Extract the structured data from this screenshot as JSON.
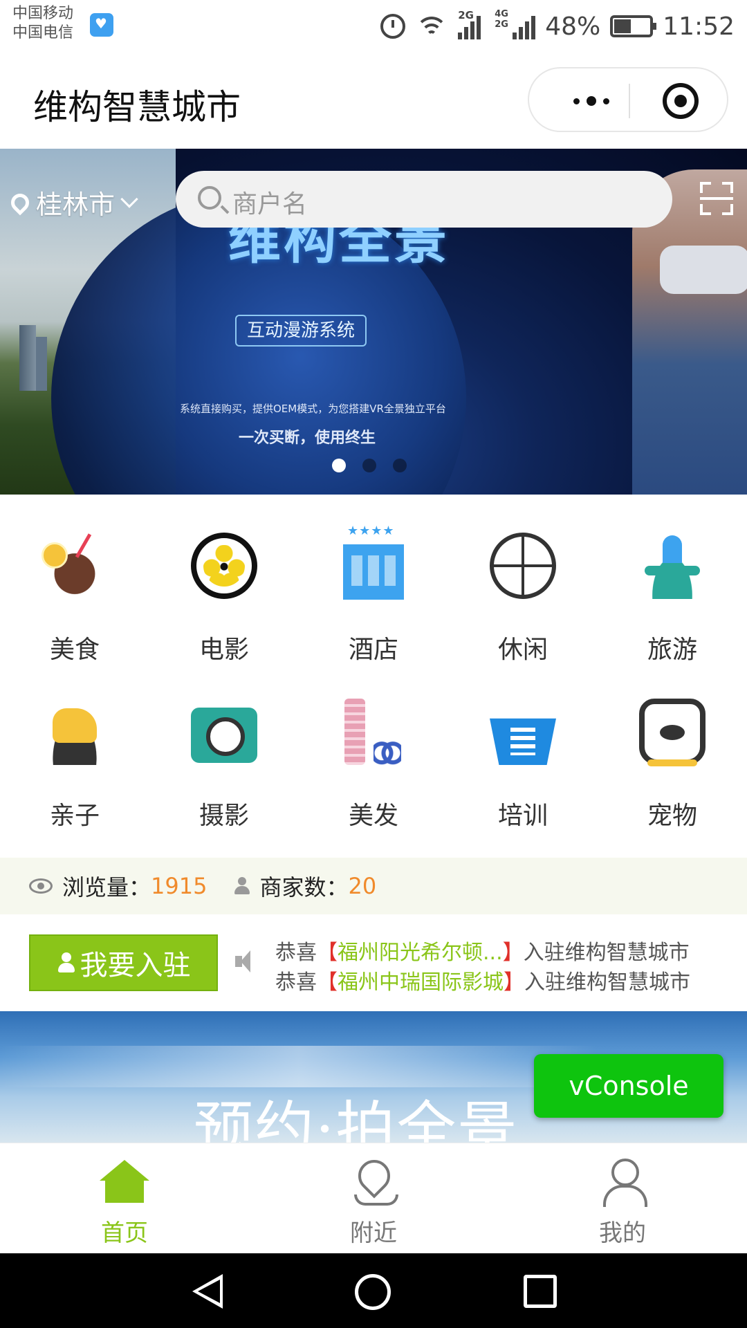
{
  "status_bar": {
    "carrier_1": "中国移动",
    "carrier_2": "中国电信",
    "network_1": "2G",
    "network_2": "4G 2G",
    "battery": "48%",
    "battery_level": 0.48,
    "time": "11:52"
  },
  "header": {
    "title": "维构智慧城市"
  },
  "banner": {
    "location": "桂林市",
    "search_placeholder": "商户名",
    "vr_title": "维构全景",
    "vr_subtitle": "互动漫游系统",
    "vr_desc": "系统直接购买，提供OEM模式，为您搭建VR全景独立平台",
    "vr_slogan": "一次买断，使用终生",
    "slide_count": 3,
    "active_slide": 1
  },
  "categories": [
    {
      "label": "美食",
      "icon": "coconut-drink-icon"
    },
    {
      "label": "电影",
      "icon": "film-reel-icon"
    },
    {
      "label": "酒店",
      "icon": "hotel-building-icon"
    },
    {
      "label": "休闲",
      "icon": "ferris-wheel-icon"
    },
    {
      "label": "旅游",
      "icon": "fountain-icon"
    },
    {
      "label": "亲子",
      "icon": "rocking-horse-icon"
    },
    {
      "label": "摄影",
      "icon": "camera-icon"
    },
    {
      "label": "美发",
      "icon": "comb-scissors-icon"
    },
    {
      "label": "培训",
      "icon": "podium-icon"
    },
    {
      "label": "宠物",
      "icon": "pet-dog-icon"
    }
  ],
  "stats": {
    "views_label": "浏览量：",
    "views_value": "1915",
    "merchants_label": "商家数：",
    "merchants_value": "20"
  },
  "join": {
    "button_label": "我要入驻",
    "notices": [
      {
        "prefix": "恭喜",
        "open": "【",
        "shop": "福州阳光希尔顿...",
        "close": "】",
        "suffix": "入驻维构智慧城市"
      },
      {
        "prefix": "恭喜",
        "open": "【",
        "shop": "福州中瑞国际影城",
        "close": "】",
        "suffix": "入驻维构智慧城市"
      }
    ]
  },
  "promo": {
    "text": "预约·拍全景"
  },
  "vconsole": {
    "label": "vConsole"
  },
  "tabbar": {
    "items": [
      {
        "label": "首页",
        "active": true
      },
      {
        "label": "附近",
        "active": false
      },
      {
        "label": "我的",
        "active": false
      }
    ]
  },
  "colors": {
    "accent_green": "#8ac519",
    "highlight_orange": "#f08a2b",
    "notice_red": "#e0302a",
    "vconsole_green": "#0ec40e"
  }
}
